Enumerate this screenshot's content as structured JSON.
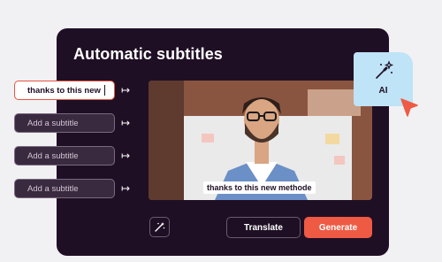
{
  "panel": {
    "title": "Automatic subtitles"
  },
  "subtitles": [
    {
      "value": "thanks to this new",
      "placeholder": "Add a subtitle"
    },
    {
      "value": "",
      "placeholder": "Add a subtitle"
    },
    {
      "value": "",
      "placeholder": "Add a subtitle"
    },
    {
      "value": "",
      "placeholder": "Add a subtitle"
    }
  ],
  "video": {
    "caption": "thanks to this new methode"
  },
  "buttons": {
    "translate": "Translate",
    "generate": "Generate"
  },
  "ai_badge": {
    "label": "AI"
  },
  "icons": {
    "arrow": "arrow-right-icon",
    "magic": "magic-wand-icon",
    "cursor": "pointer-cursor-icon"
  },
  "colors": {
    "panel_bg": "#1f0f24",
    "accent": "#ee5a44",
    "ai_badge_bg": "#bfe3f7"
  }
}
